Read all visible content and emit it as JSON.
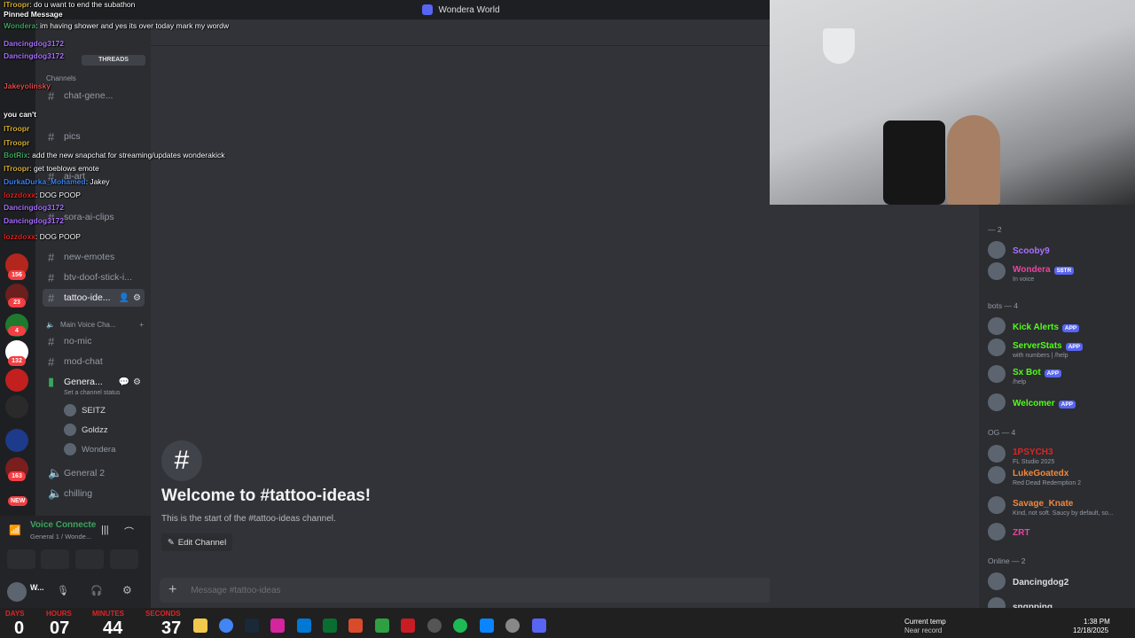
{
  "window": {
    "title": "Wondera World"
  },
  "overlay": {
    "lines": [
      {
        "name": "ITroopr",
        "text": "do u want to end the subathon",
        "color": "#d4af37"
      },
      {
        "name": "",
        "text": "Pinned Message",
        "color": "#ffffff"
      },
      {
        "name": "Wondera",
        "text": "im having shower and yes its over today mark my wordw",
        "color": "#3ba55d"
      },
      {
        "name": "Dancingdog3172",
        "text": "",
        "color": "#a970ff"
      },
      {
        "name": "Dancingdog3172",
        "text": "",
        "color": "#a970ff"
      },
      {
        "name": "Jakeyolinsky",
        "text": "",
        "color": "#e24b4b"
      },
      {
        "name": "",
        "text": "you can't",
        "color": "#ffffff"
      },
      {
        "name": "ITroopr",
        "text": "",
        "color": "#d4af37"
      },
      {
        "name": "ITroopr",
        "text": "",
        "color": "#d4af37"
      },
      {
        "name": "BotRix",
        "text": "add the new snapchat for streaming/updates wonderakick",
        "color": "#3ba55d"
      },
      {
        "name": "ITroopr",
        "text": "get toeblows emote",
        "color": "#d4af37"
      },
      {
        "name": "DurkaDurka_Mohamed",
        "text": "Jakey",
        "color": "#3b82f6"
      },
      {
        "name": "lozzdoxx",
        "text": "DOG POOP",
        "color": "#e02424"
      },
      {
        "name": "Dancingdog3172",
        "text": "",
        "color": "#a970ff"
      },
      {
        "name": "Dancingdog3172",
        "text": "",
        "color": "#a970ff"
      },
      {
        "name": "lozzdoxx",
        "text": "DOG POOP",
        "color": "#e02424"
      }
    ]
  },
  "sidebar": {
    "threads_label": "THREADS",
    "channels_label": "Channels",
    "channels_top": [
      {
        "label": "chat-gene..."
      },
      {
        "label": "pics"
      },
      {
        "label": "ai-art"
      },
      {
        "label": "sora-ai-clips"
      },
      {
        "label": "new-emotes"
      },
      {
        "label": "btv-doof-stick-i..."
      },
      {
        "label": "tattoo-ide..."
      }
    ],
    "voice_category": "Main Voice Cha...",
    "voice_channels": [
      {
        "label": "no-mic"
      },
      {
        "label": "mod-chat"
      }
    ],
    "general_voice": "Genera...",
    "channel_status": "Set a channel status",
    "voice_users": [
      {
        "label": "SEITZ"
      },
      {
        "label": "Goldzz"
      },
      {
        "label": "Wondera"
      }
    ],
    "general2": "General 2",
    "chilling": "chilling"
  },
  "servers": {
    "badges": [
      "156",
      "23",
      "4",
      "132",
      "163",
      "NEW"
    ]
  },
  "voice_panel": {
    "status": "Voice Connecte",
    "channel": "General 1 / Wonde..."
  },
  "user_panel": {
    "name": "W..."
  },
  "main": {
    "welcome_icon": "#",
    "welcome_title": "Welcome to #tattoo-ideas!",
    "welcome_sub": "This is the start of the #tattoo-ideas channel.",
    "edit_button": "Edit Channel",
    "message_placeholder": "Message #tattoo-ideas"
  },
  "members": {
    "groups": [
      {
        "header": "— 2",
        "members": [
          {
            "name": "Scooby9",
            "color": "#a970ff",
            "sub": ""
          },
          {
            "name": "Wondera",
            "color": "#eb459e",
            "sub": "In voice",
            "tag": "S$TR"
          }
        ]
      },
      {
        "header": "bots — 4",
        "members": [
          {
            "name": "Kick Alerts",
            "color": "#53fc18",
            "sub": "",
            "tag": "APP"
          },
          {
            "name": "ServerStats",
            "color": "#53fc18",
            "sub": "with numbers | /help",
            "tag": "APP"
          },
          {
            "name": "Sx Bot",
            "color": "#53fc18",
            "sub": "/help",
            "tag": "APP"
          },
          {
            "name": "Welcomer",
            "color": "#53fc18",
            "sub": "",
            "tag": "APP"
          }
        ]
      },
      {
        "header": "OG — 4",
        "members": [
          {
            "name": "1PSYCH3",
            "color": "#e02424",
            "sub": "FL Studio 2025"
          },
          {
            "name": "LukeGoatedx",
            "color": "#f0883e",
            "sub": "Red Dead Redemption 2"
          },
          {
            "name": "Savage_Knate",
            "color": "#f0883e",
            "sub": "Kind, not soft. Saucy by default, so..."
          },
          {
            "name": "ZRT",
            "color": "#eb459e",
            "sub": ""
          }
        ]
      },
      {
        "header": "Online — 2",
        "members": [
          {
            "name": "Dancingdog2",
            "color": "#dbdee1",
            "sub": ""
          },
          {
            "name": "snqpping",
            "color": "#dbdee1",
            "sub": ""
          }
        ]
      }
    ]
  },
  "timer": {
    "days_label": "DAYS",
    "hours_label": "HOURS",
    "minutes_label": "MINUTES",
    "seconds_label": "SECONDS",
    "days": "0",
    "hours": "07",
    "minutes": "44",
    "seconds": "37"
  },
  "tray": {
    "weather_title": "Current temp",
    "weather_sub": "Near record",
    "time": "1:38 PM",
    "date": "12/18/2025"
  }
}
